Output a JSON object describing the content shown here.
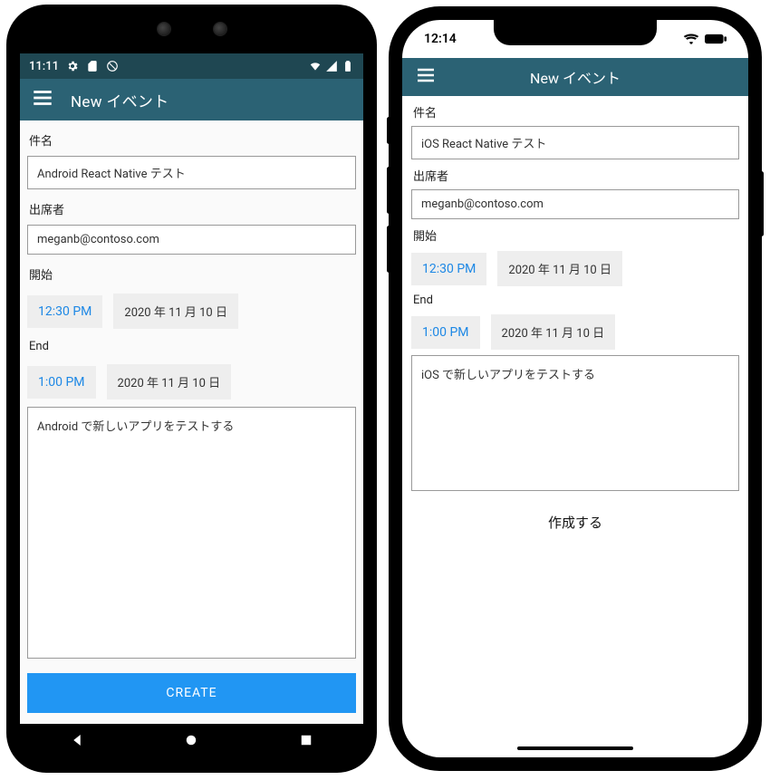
{
  "android": {
    "status_time": "11:11",
    "header_title": "New イベント",
    "labels": {
      "subject": "件名",
      "attendees": "出席者",
      "start": "開始",
      "end": "End"
    },
    "subject_value": "Android React Native テスト",
    "attendees_value": "meganb@contoso.com",
    "start_time": "12:30 PM",
    "start_date": "2020 年 11 月 10 日",
    "end_time": "1:00 PM",
    "end_date": "2020 年 11 月 10 日",
    "body_value": "Android で新しいアプリをテストする",
    "create_label": "CREATE"
  },
  "ios": {
    "status_time": "12:14",
    "header_title": "New イベント",
    "labels": {
      "subject": "件名",
      "attendees": "出席者",
      "start": "開始",
      "end": "End"
    },
    "subject_value": "iOS React Native テスト",
    "attendees_value": "meganb@contoso.com",
    "start_time": "12:30 PM",
    "start_date": "2020 年 11 月 10 日",
    "end_time": "1:00 PM",
    "end_date": "2020 年 11 月 10 日",
    "body_value": "iOS で新しいアプリをテストする",
    "create_label": "作成する"
  }
}
